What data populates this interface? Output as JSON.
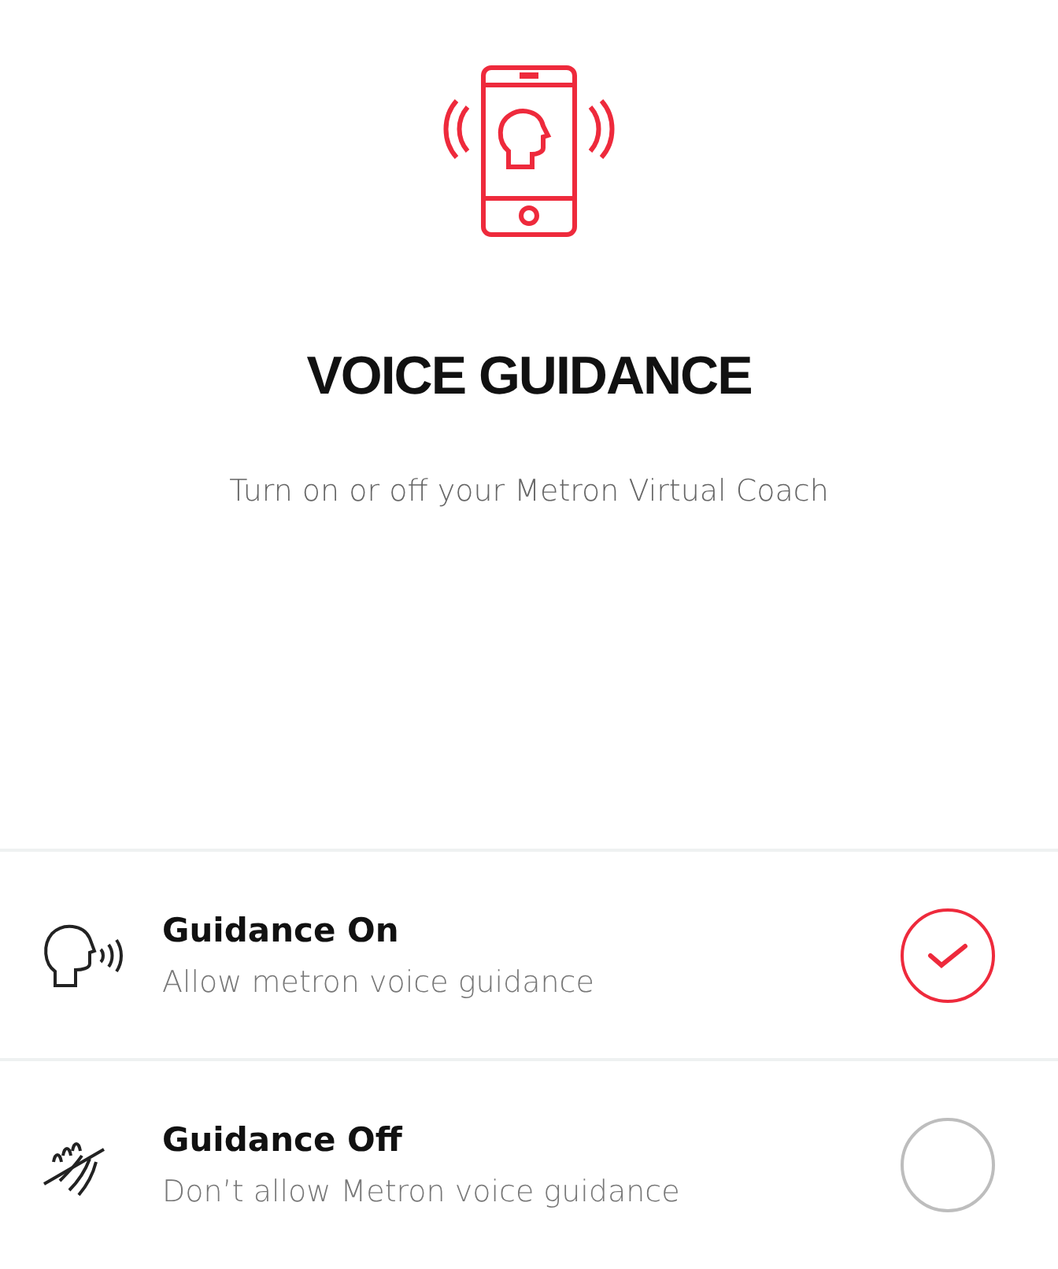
{
  "header": {
    "title": "VOICE GUIDANCE",
    "subtitle": "Turn on or off your Metron Virtual Coach"
  },
  "options": [
    {
      "kind": "voice-on",
      "title": "Guidance On",
      "description": "Allow metron voice guidance",
      "selected": true
    },
    {
      "kind": "voice-off",
      "title": "Guidance Off",
      "description": "Don’t allow Metron voice guidance",
      "selected": false
    }
  ]
}
